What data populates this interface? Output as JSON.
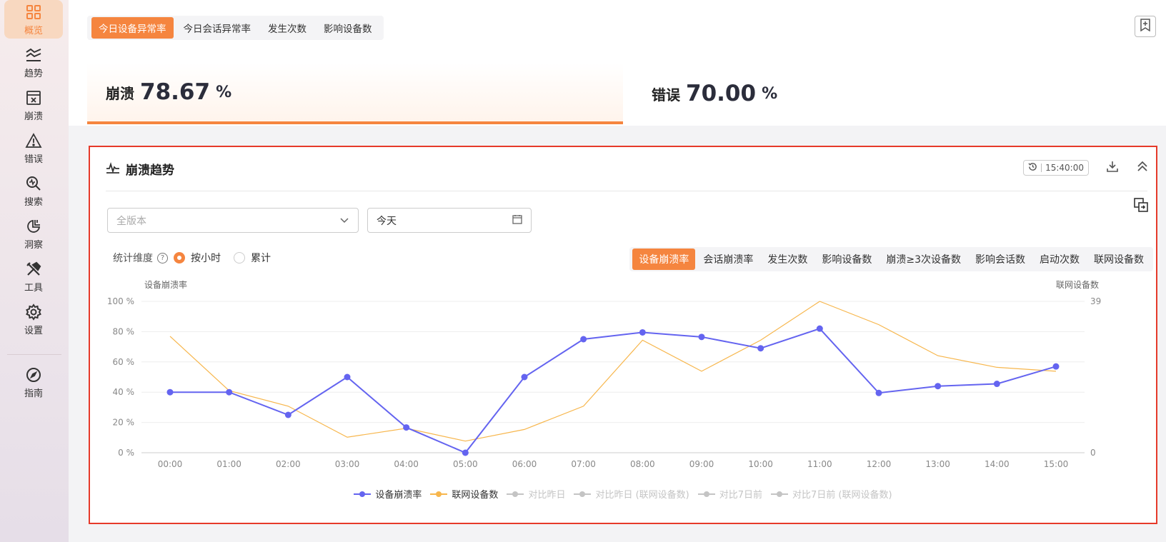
{
  "sidebar": {
    "items": [
      {
        "label": "概览",
        "icon": "dashboard-icon"
      },
      {
        "label": "趋势",
        "icon": "trend-icon"
      },
      {
        "label": "崩溃",
        "icon": "crash-icon"
      },
      {
        "label": "错误",
        "icon": "warning-icon"
      },
      {
        "label": "搜索",
        "icon": "search-icon"
      },
      {
        "label": "洞察",
        "icon": "insight-icon"
      },
      {
        "label": "工具",
        "icon": "tools-icon"
      },
      {
        "label": "设置",
        "icon": "gear-icon"
      },
      {
        "label": "指南",
        "icon": "compass-icon"
      }
    ]
  },
  "top": {
    "tabs": [
      "今日设备异常率",
      "今日会话异常率",
      "发生次数",
      "影响设备数"
    ],
    "metrics": [
      {
        "label": "崩溃",
        "value": "78.67",
        "unit": "%"
      },
      {
        "label": "错误",
        "value": "70.00",
        "unit": "%"
      }
    ]
  },
  "card": {
    "title": "崩溃趋势",
    "time": "15:40:00",
    "version_placeholder": "全版本",
    "date_value": "今天",
    "dimension_label": "统计维度",
    "radios": [
      "按小时",
      "累计"
    ],
    "metric_tabs": [
      "设备崩溃率",
      "会话崩溃率",
      "发生次数",
      "影响设备数",
      "崩溃≥3次设备数",
      "影响会话数",
      "启动次数",
      "联网设备数"
    ]
  },
  "colors": {
    "accent": "#f5853f",
    "series1": "#6464f0",
    "series2": "#f7b64c",
    "legend_off": "#c4c4c4"
  },
  "chart_data": {
    "type": "line",
    "ylabel": "设备崩溃率",
    "ylabel_right": "联网设备数",
    "x": [
      "00:00",
      "01:00",
      "02:00",
      "03:00",
      "04:00",
      "05:00",
      "06:00",
      "07:00",
      "08:00",
      "09:00",
      "10:00",
      "11:00",
      "12:00",
      "13:00",
      "14:00",
      "15:00"
    ],
    "y_ticks": [
      "0 %",
      "20 %",
      "40 %",
      "60 %",
      "80 %",
      "100 %"
    ],
    "ylim": [
      0,
      100
    ],
    "y2_ticks": [
      "0",
      "39"
    ],
    "y2lim": [
      0,
      39
    ],
    "series": [
      {
        "name": "设备崩溃率",
        "axis": "left",
        "values": [
          40,
          40,
          25,
          50,
          16.7,
          0,
          50,
          75,
          79.5,
          76.5,
          69,
          82,
          39.5,
          44,
          45.5,
          57
        ]
      },
      {
        "name": "联网设备数",
        "axis": "right",
        "values": [
          30,
          16,
          12,
          4,
          6.3,
          3,
          6,
          12,
          29,
          21,
          29,
          39,
          33,
          25,
          22,
          21
        ]
      }
    ],
    "legend": [
      {
        "name": "设备崩溃率",
        "active": true
      },
      {
        "name": "联网设备数",
        "active": true
      },
      {
        "name": "对比昨日",
        "active": false
      },
      {
        "name": "对比昨日 (联网设备数)",
        "active": false
      },
      {
        "name": "对比7日前",
        "active": false
      },
      {
        "name": "对比7日前 (联网设备数)",
        "active": false
      }
    ],
    "legend_position": "bottom-center",
    "grid": true
  }
}
